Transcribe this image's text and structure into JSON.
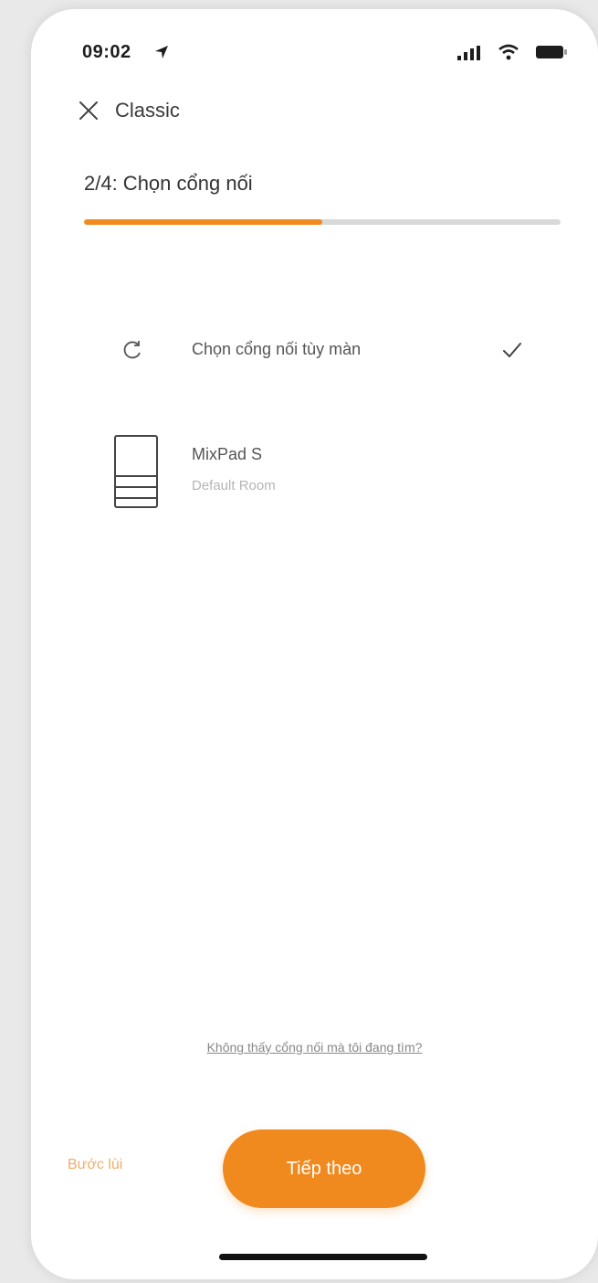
{
  "status_bar": {
    "time": "09:02"
  },
  "header": {
    "title": "Classic"
  },
  "step": {
    "label": "2/4: Chọn cổng nối",
    "progress": 0.5
  },
  "gateway_select": {
    "option_label": "Chọn cổng nối tùy màn",
    "selected": true
  },
  "device": {
    "name": "MixPad S",
    "room": "Default Room"
  },
  "help_link": "Không thấy cổng nối mà tôi đang tìm?",
  "footer": {
    "back_label": "Bước lùi",
    "next_label": "Tiếp theo"
  },
  "colors": {
    "accent": "#f08a1f",
    "accent_light": "#f0ae6a",
    "track": "#d9d9d9"
  }
}
